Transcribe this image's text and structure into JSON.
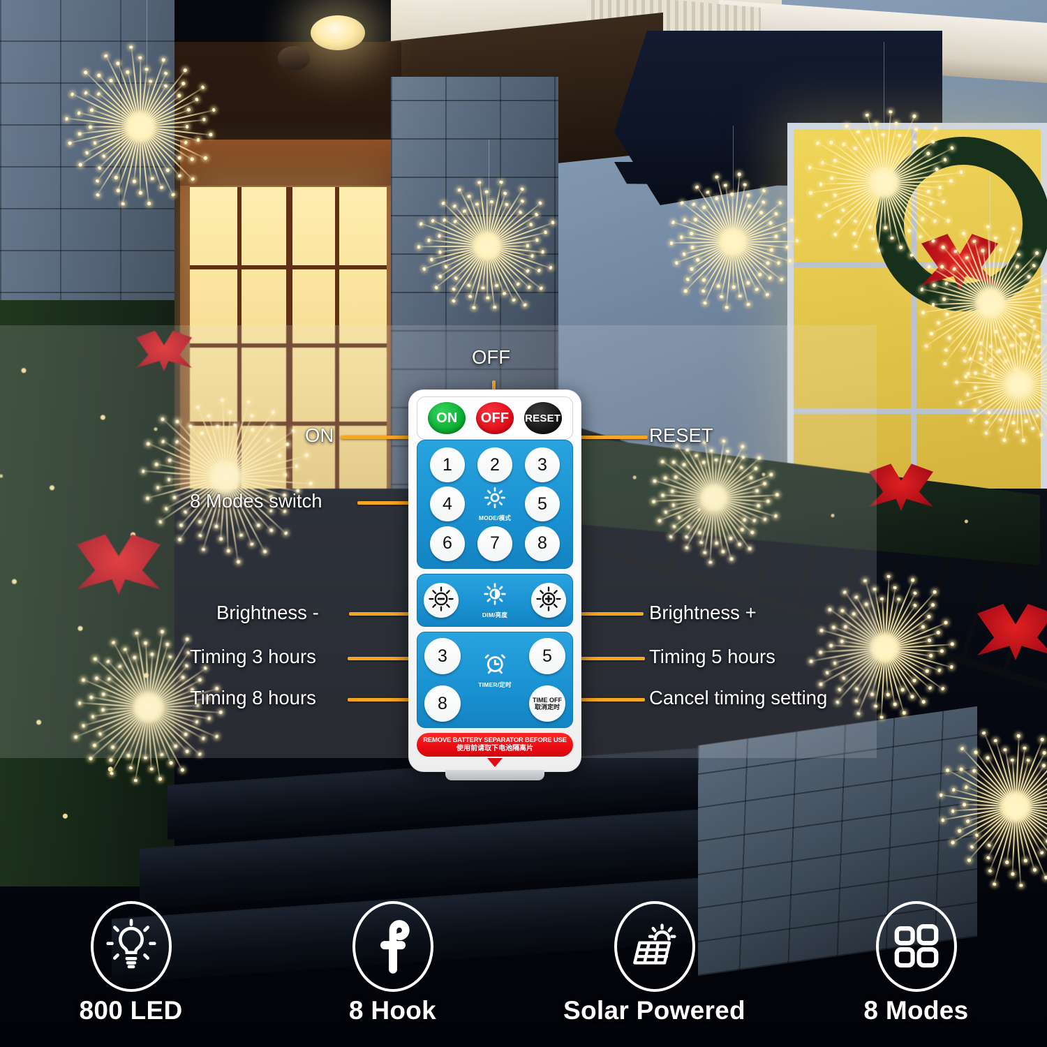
{
  "scene": {
    "description": "Outdoor holiday porch at dusk with starburst firework LED string lights, wreath, garland and stone steps"
  },
  "remote": {
    "top_row": [
      {
        "label": "ON",
        "color": "#06a92f",
        "name": "power-on-button"
      },
      {
        "label": "OFF",
        "color": "#e00b17",
        "name": "power-off-button"
      },
      {
        "label": "RESET",
        "color": "#111111",
        "name": "reset-button"
      }
    ],
    "mode_buttons": [
      "1",
      "2",
      "3",
      "4",
      "5",
      "6",
      "7",
      "8"
    ],
    "mode_center_label": "MODE/模式",
    "dim_center_label": "DIM/亮度",
    "dim_minus": "−",
    "dim_plus": "+",
    "timer_center_label": "TIMER/定时",
    "timer_buttons": [
      "3",
      "5",
      "8"
    ],
    "time_off_line1": "TIME OFF",
    "time_off_line2": "取消定时",
    "warning_line1": "REMOVE BATTERY SEPARATOR BEFORE USE",
    "warning_line2": "使用前请取下电池隔离片",
    "accent_blue": "#1b93d3",
    "accent_red": "#e00b17",
    "leader_color": "#f5a623"
  },
  "callouts": {
    "off": "OFF",
    "on": "ON",
    "reset": "RESET",
    "modes_switch": "8 Modes switch",
    "brightness_minus": "Brightness -",
    "brightness_plus": "Brightness +",
    "timing_3": "Timing 3 hours",
    "timing_5": "Timing 5 hours",
    "timing_8": "Timing 8 hours",
    "cancel_timing": "Cancel timing setting"
  },
  "features": [
    {
      "label": "800 LED",
      "icon": "lightbulb-icon"
    },
    {
      "label": "8 Hook",
      "icon": "hook-icon"
    },
    {
      "label": "Solar Powered",
      "icon": "solar-panel-icon"
    },
    {
      "label": "8 Modes",
      "icon": "four-squares-icon"
    }
  ]
}
